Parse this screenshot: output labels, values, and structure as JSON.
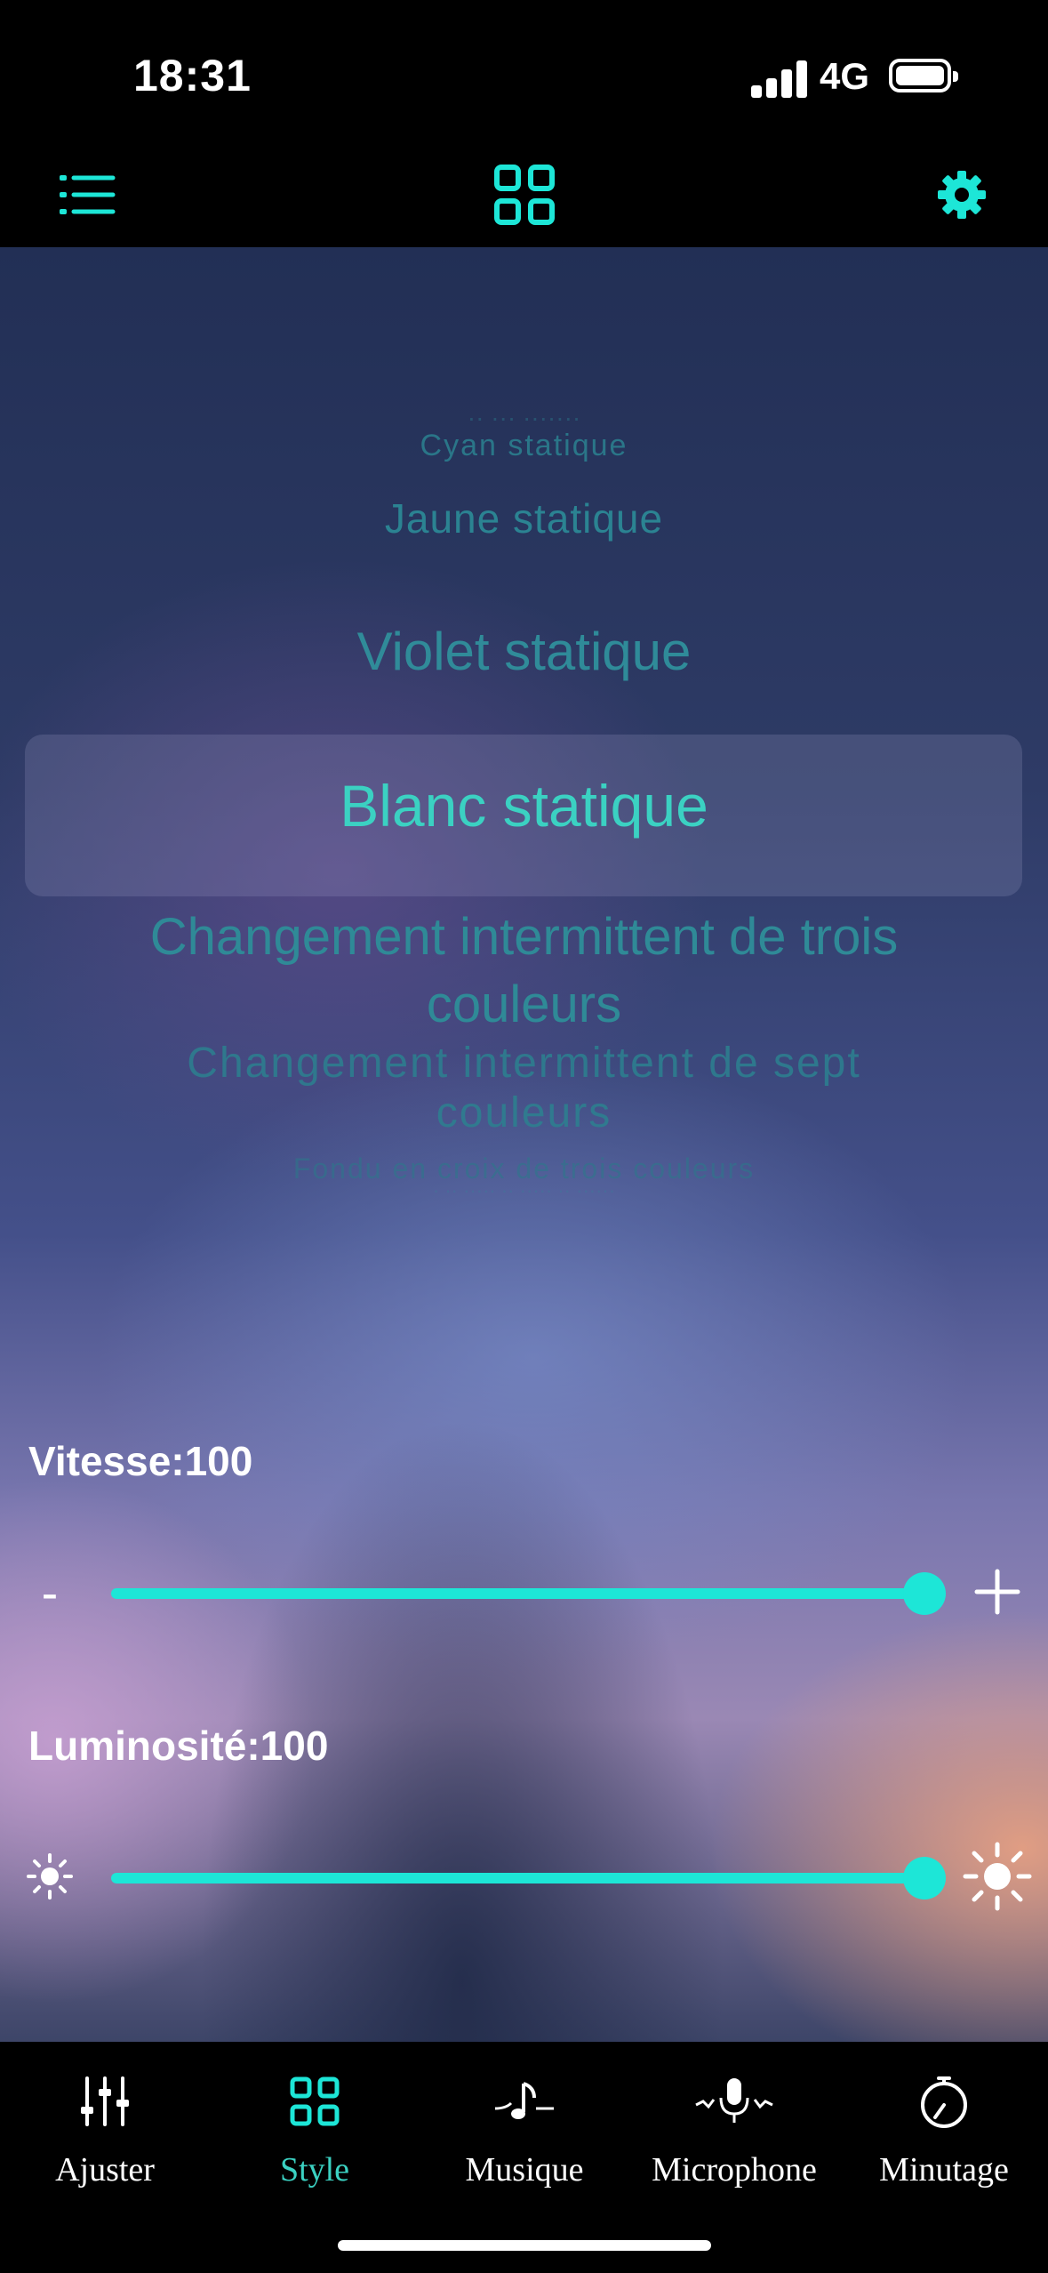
{
  "status_bar": {
    "time": "18:31",
    "network": "4G"
  },
  "top_nav": {
    "left_icon": "list-icon",
    "center_icon": "grid-icon",
    "right_icon": "gear-icon",
    "accent_color": "#1de6d7"
  },
  "mode_picker": {
    "items_above": [
      "Cyan statique",
      "Jaune statique",
      "Violet statique"
    ],
    "selected": "Blanc statique",
    "items_below": [
      "Changement intermittent de trois couleurs",
      "Changement intermittent de sept couleurs",
      "Fondu en croix de trois couleurs"
    ]
  },
  "speed": {
    "label": "Vitesse:100",
    "value": 100,
    "max": 100,
    "min_symbol": "-",
    "max_icon": "plus-icon"
  },
  "brightness": {
    "label": "Luminosité:100",
    "value": 100,
    "max": 100,
    "min_icon": "sun-small-icon",
    "max_icon": "sun-large-icon"
  },
  "tab_bar": {
    "tabs": [
      {
        "label": "Ajuster",
        "icon": "sliders-icon"
      },
      {
        "label": "Style",
        "icon": "grid-icon",
        "active": true
      },
      {
        "label": "Musique",
        "icon": "music-note-icon"
      },
      {
        "label": "Microphone",
        "icon": "microphone-icon"
      },
      {
        "label": "Minutage",
        "icon": "timer-icon"
      }
    ]
  }
}
